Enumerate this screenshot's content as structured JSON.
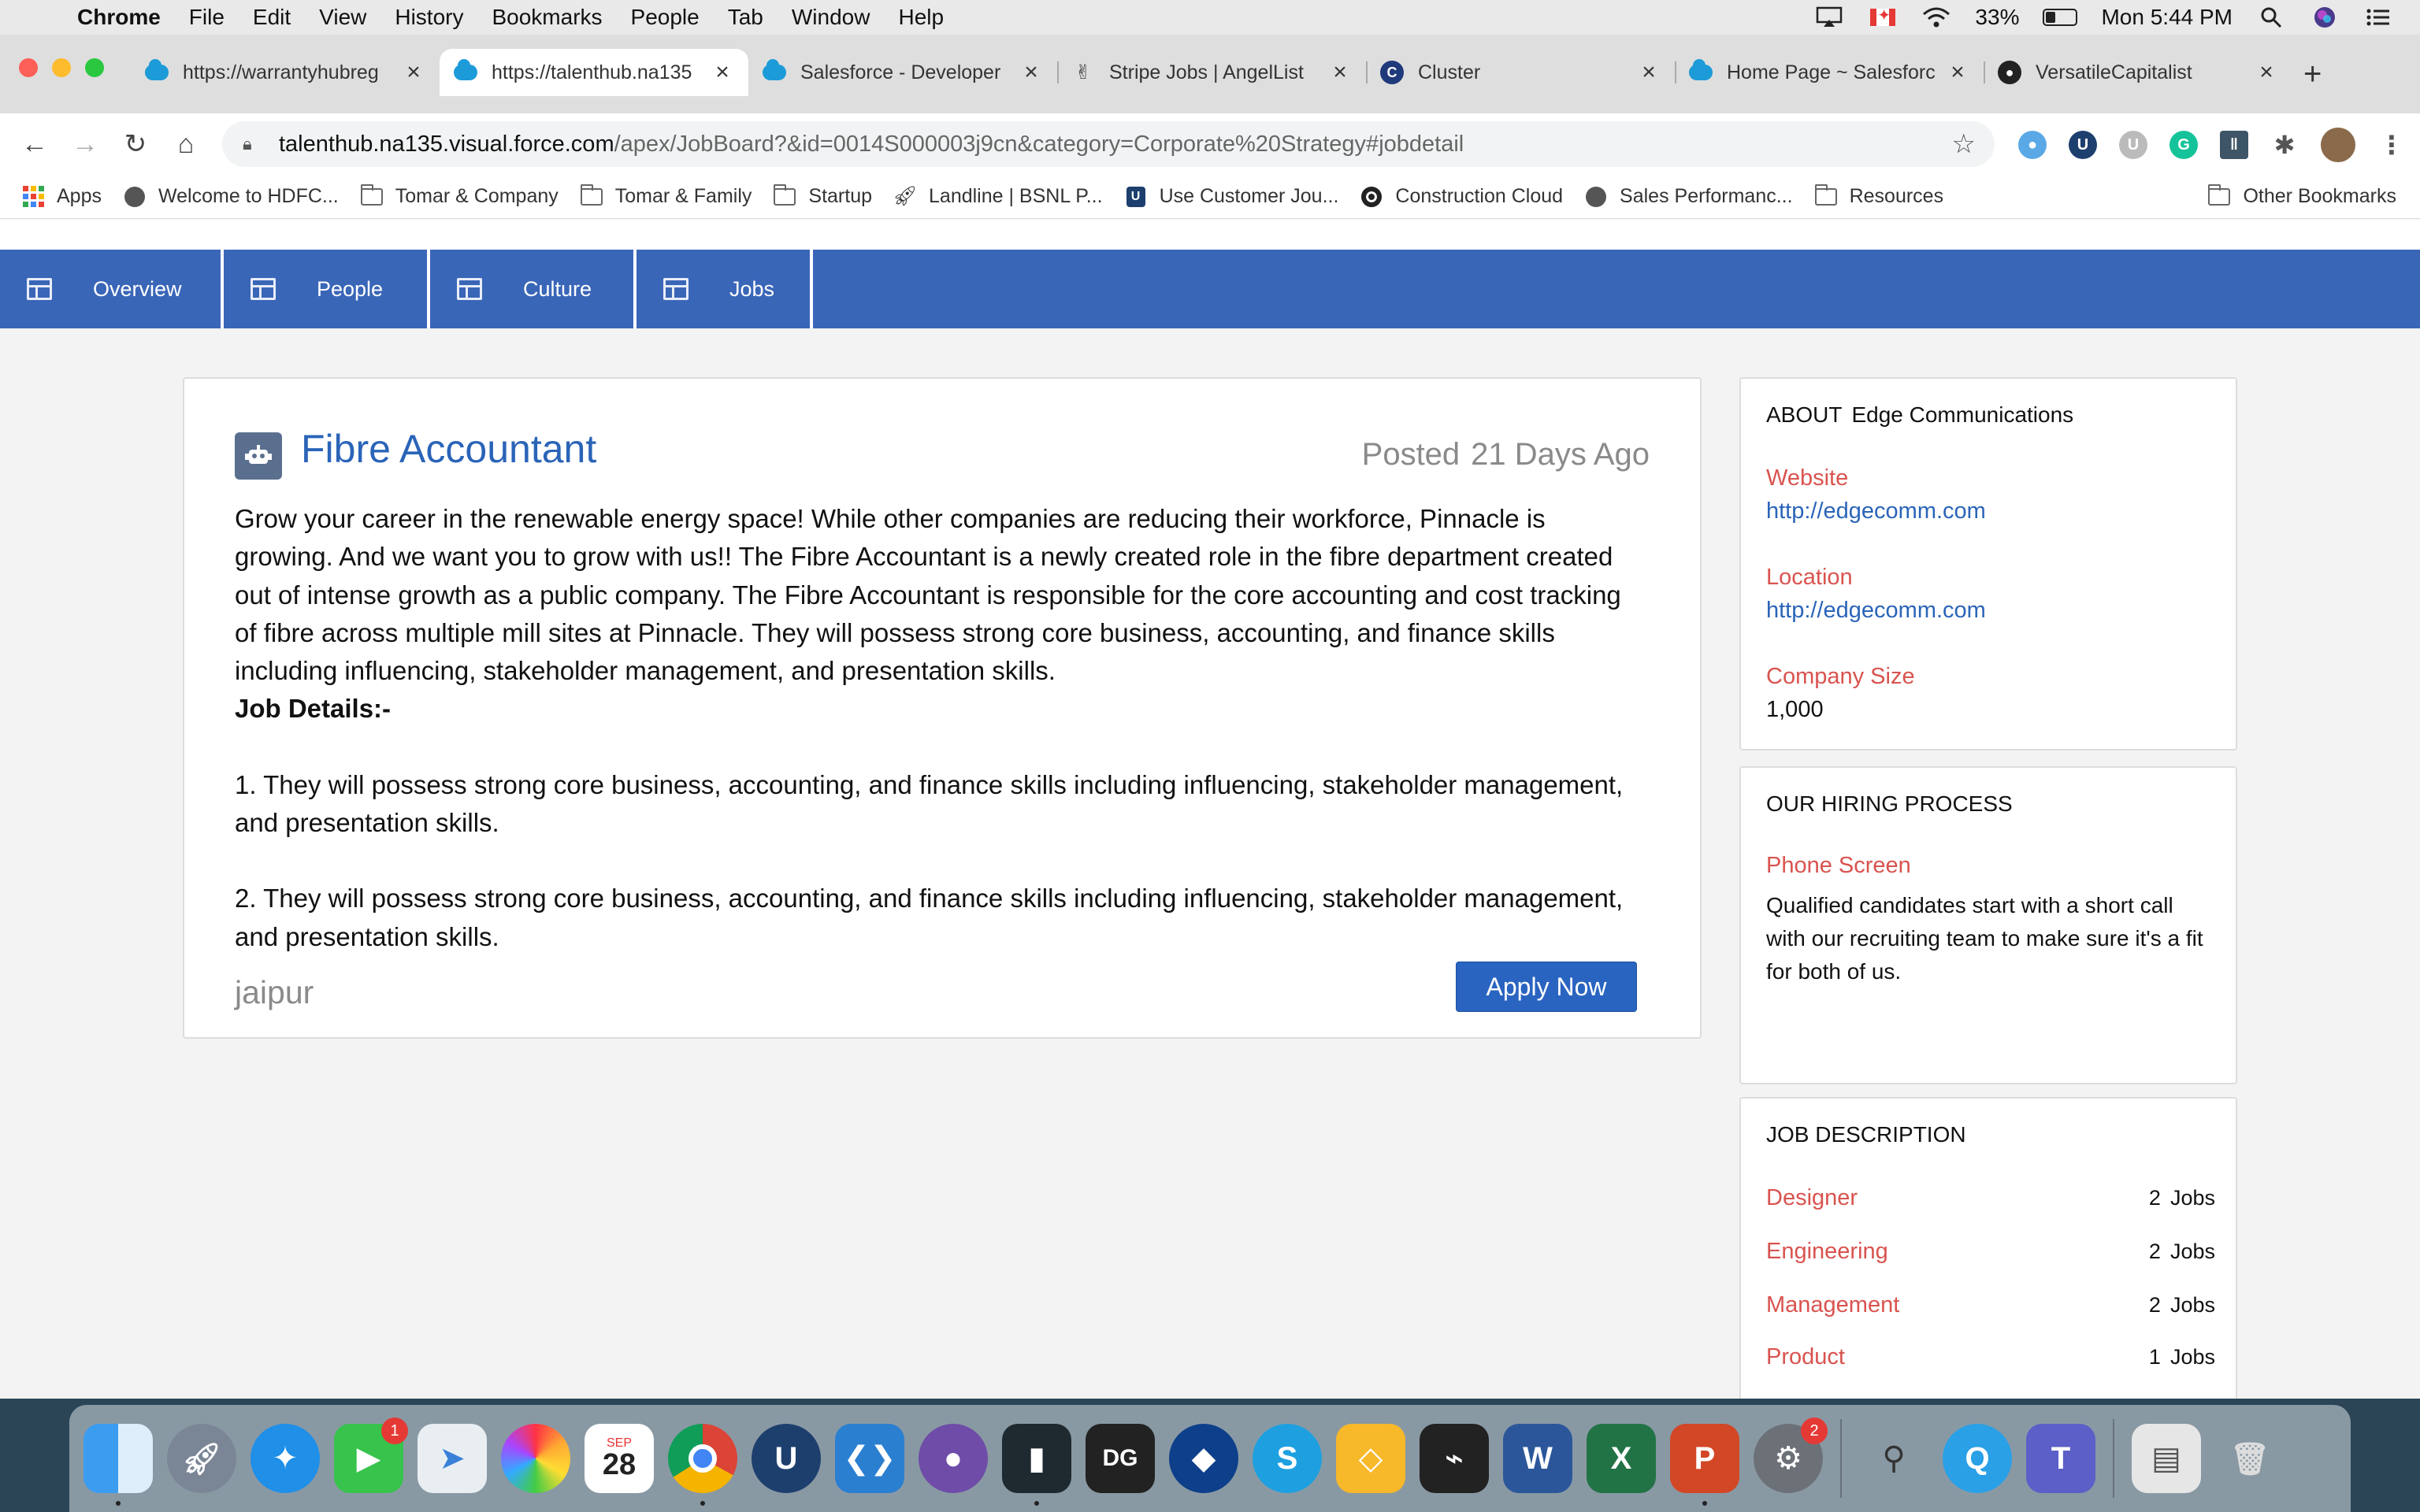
{
  "menubar": {
    "items": [
      "Chrome",
      "File",
      "Edit",
      "View",
      "History",
      "Bookmarks",
      "People",
      "Tab",
      "Window",
      "Help"
    ],
    "battery_text": "33%",
    "battery_level": 0.33,
    "clock": "Mon 5:44 PM"
  },
  "tabs": [
    {
      "label": "https://warrantyhubreg",
      "icon": "salesforce-cloud-icon"
    },
    {
      "label": "https://talenthub.na135",
      "icon": "salesforce-cloud-icon",
      "active": true
    },
    {
      "label": "Salesforce - Developer",
      "icon": "salesforce-cloud-icon"
    },
    {
      "label": "Stripe Jobs | AngelList",
      "icon": "angellist-hand-icon"
    },
    {
      "label": "Cluster",
      "icon": "cluster-icon"
    },
    {
      "label": "Home Page ~ Salesforc",
      "icon": "salesforce-cloud-icon"
    },
    {
      "label": "VersatileCapitalist",
      "icon": "github-icon"
    }
  ],
  "address": {
    "host": "talenthub.na135.visual.force.com",
    "path": "/apex/JobBoard?&id=0014S000003j9cn&category=Corporate%20Strategy#jobdetail"
  },
  "bookmarks": [
    {
      "label": "Apps",
      "icon": "apps-grid-icon"
    },
    {
      "label": "Welcome to HDFC...",
      "icon": "globe-icon"
    },
    {
      "label": "Tomar & Company",
      "icon": "folder-icon"
    },
    {
      "label": "Tomar & Family",
      "icon": "folder-icon"
    },
    {
      "label": "Startup",
      "icon": "folder-icon"
    },
    {
      "label": "Landline | BSNL P...",
      "icon": "rocket-icon"
    },
    {
      "label": "Use Customer Jou...",
      "icon": "u-shield-icon"
    },
    {
      "label": "Construction Cloud",
      "icon": "target-icon"
    },
    {
      "label": "Sales Performanc...",
      "icon": "globe-icon"
    },
    {
      "label": "Resources",
      "icon": "folder-icon"
    }
  ],
  "other_bookmarks": "Other Bookmarks",
  "nav": {
    "tabs": [
      "Overview",
      "People",
      "Culture",
      "Jobs"
    ]
  },
  "job": {
    "title": "Fibre Accountant",
    "posted_label": "Posted",
    "posted_ago": "21 Days Ago",
    "description": "Grow your career in the renewable energy space! While other companies are reducing their workforce, Pinnacle is growing. And we want you to grow with us!! The Fibre Accountant is a newly created role in the fibre department created out of intense growth as a public company. The Fibre Accountant is responsible for the core accounting and cost tracking of fibre across multiple mill sites at Pinnacle. They will possess strong core business, accounting, and finance skills including influencing, stakeholder management, and presentation skills.",
    "details_heading": "Job Details:-",
    "details": [
      "1. They will possess strong core business, accounting, and finance skills including influencing, stakeholder management, and presentation skills.",
      "2. They will possess strong core business, accounting, and finance skills including influencing, stakeholder management, and presentation skills."
    ],
    "location": "jaipur",
    "apply_label": "Apply Now"
  },
  "about": {
    "heading": "ABOUT",
    "company": "Edge Communications",
    "website_label": "Website",
    "website_value": "http://edgecomm.com",
    "location_label": "Location",
    "location_value": "http://edgecomm.com",
    "size_label": "Company Size",
    "size_value": "1,000"
  },
  "hiring": {
    "heading": "OUR HIRING PROCESS",
    "step_label": "Phone Screen",
    "step_text": "Qualified candidates start with a short call with our recruiting team to make sure it's a fit for both of us."
  },
  "job_description": {
    "heading": "JOB DESCRIPTION",
    "jobs_word": "Jobs",
    "rows": [
      {
        "category": "Designer",
        "count": "2"
      },
      {
        "category": "Engineering",
        "count": "2"
      },
      {
        "category": "Management",
        "count": "2"
      },
      {
        "category": "Product",
        "count": "1"
      }
    ]
  },
  "dock": {
    "calendar_month": "SEP",
    "calendar_day": "28",
    "facetime_badge": "1",
    "settings_badge": "2"
  },
  "colors": {
    "nav_blue": "#3a66b8",
    "link_blue": "#2a64b8",
    "label_red": "#d9534f",
    "button_blue": "#2a64c1"
  }
}
